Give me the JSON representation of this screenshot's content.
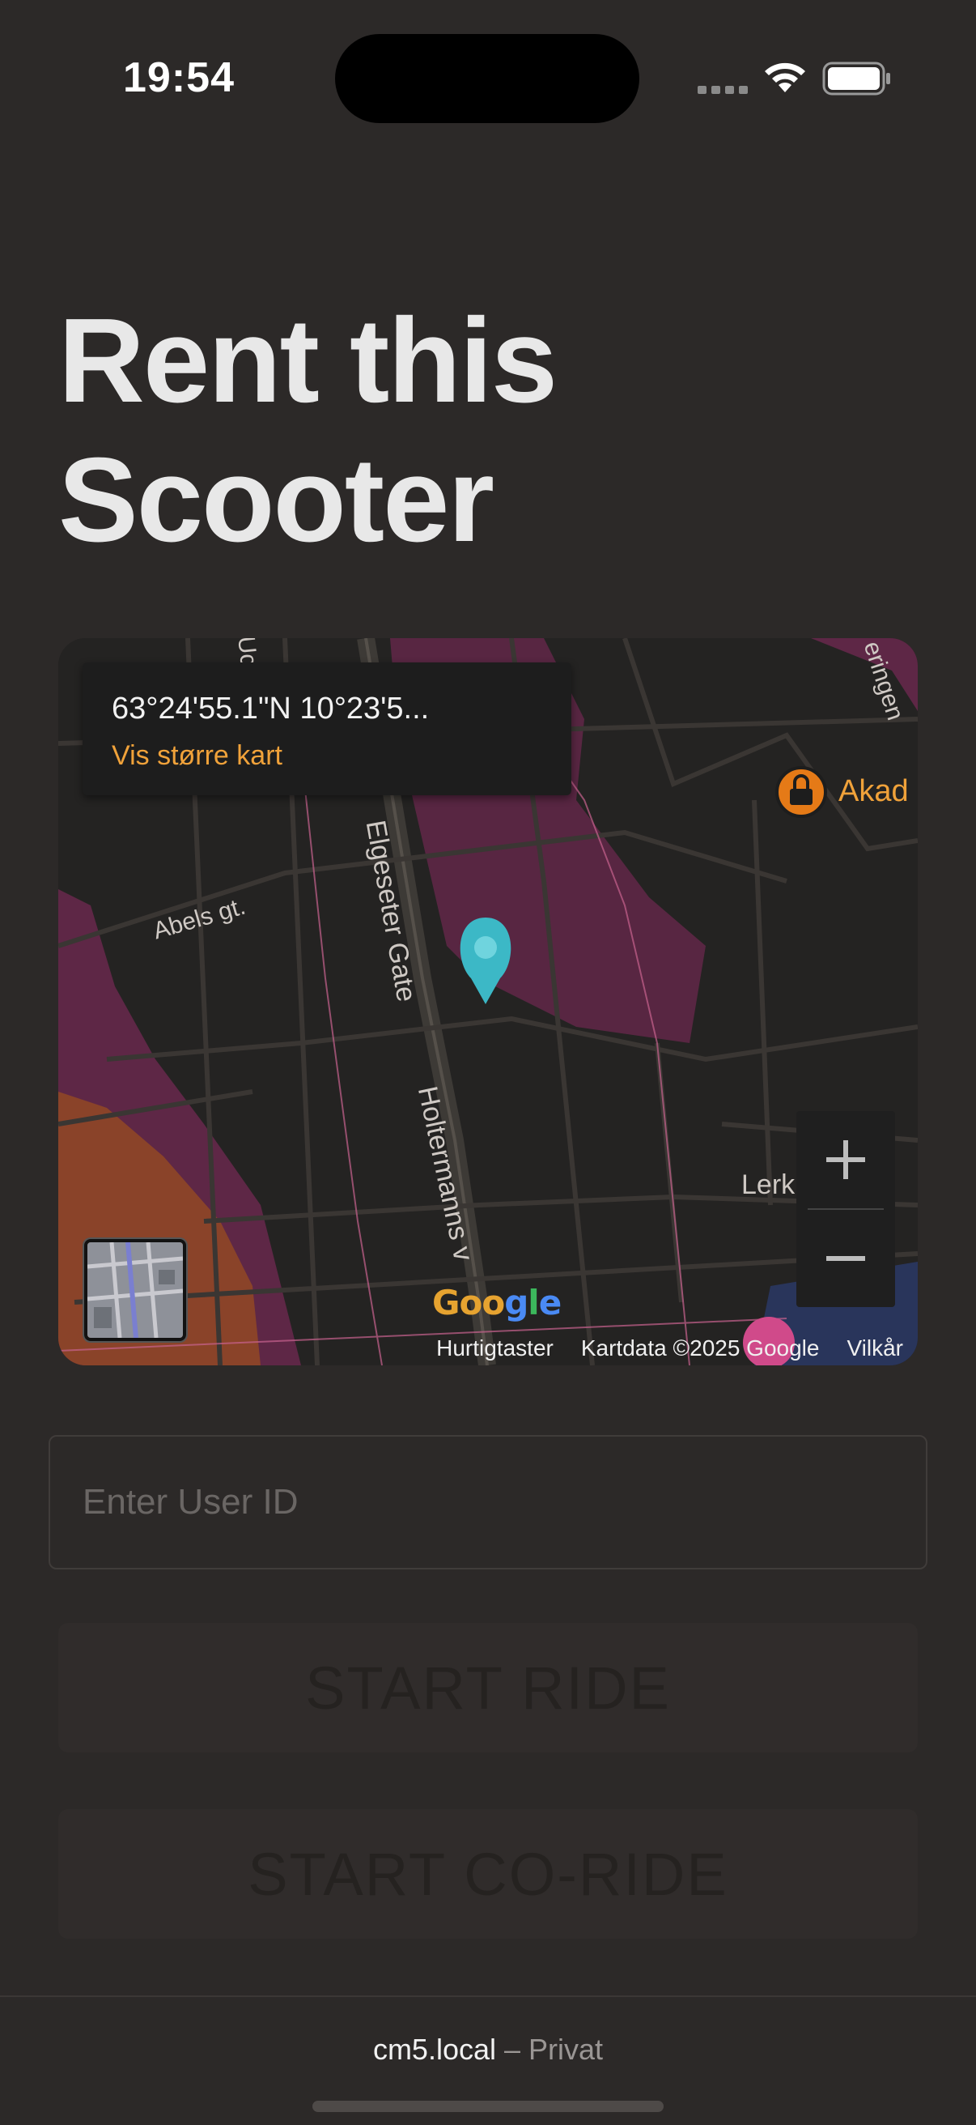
{
  "status_bar": {
    "time": "19:54",
    "signal_icon": "signal-dots-icon",
    "wifi_icon": "wifi-icon",
    "battery_icon": "battery-icon"
  },
  "page": {
    "title_line1": "Rent this",
    "title_line2": "Scooter"
  },
  "map": {
    "coordinates": "63°24'55.1\"N 10°23'5...",
    "larger_map_link": "Vis større kart",
    "zoom_in": "+",
    "zoom_out": "−",
    "street_labels": {
      "abels": "Abels gt.",
      "elgeseter": "Elgeseter Gate",
      "holtermanns": "Holtermanns v",
      "lerk": "Lerk        st",
      "akad": "Akad",
      "ringen": "eringen",
      "uc": "Uc"
    },
    "logo": "Google",
    "attribution": {
      "shortcuts": "Hurtigtaster",
      "map_data": "Kartdata ©2025 Google",
      "terms": "Vilkår"
    },
    "colors": {
      "pin": "#3cb8c6",
      "park": "#6b2a4f",
      "orange_area": "#8a4329",
      "poi_orange": "#e57a17"
    }
  },
  "form": {
    "user_id_placeholder": "Enter User ID",
    "user_id_value": "",
    "start_ride_label": "START RIDE",
    "start_co_ride_label": "START CO-RIDE"
  },
  "browser": {
    "host": "cm5.local",
    "separator": " – ",
    "mode": "Privat"
  }
}
